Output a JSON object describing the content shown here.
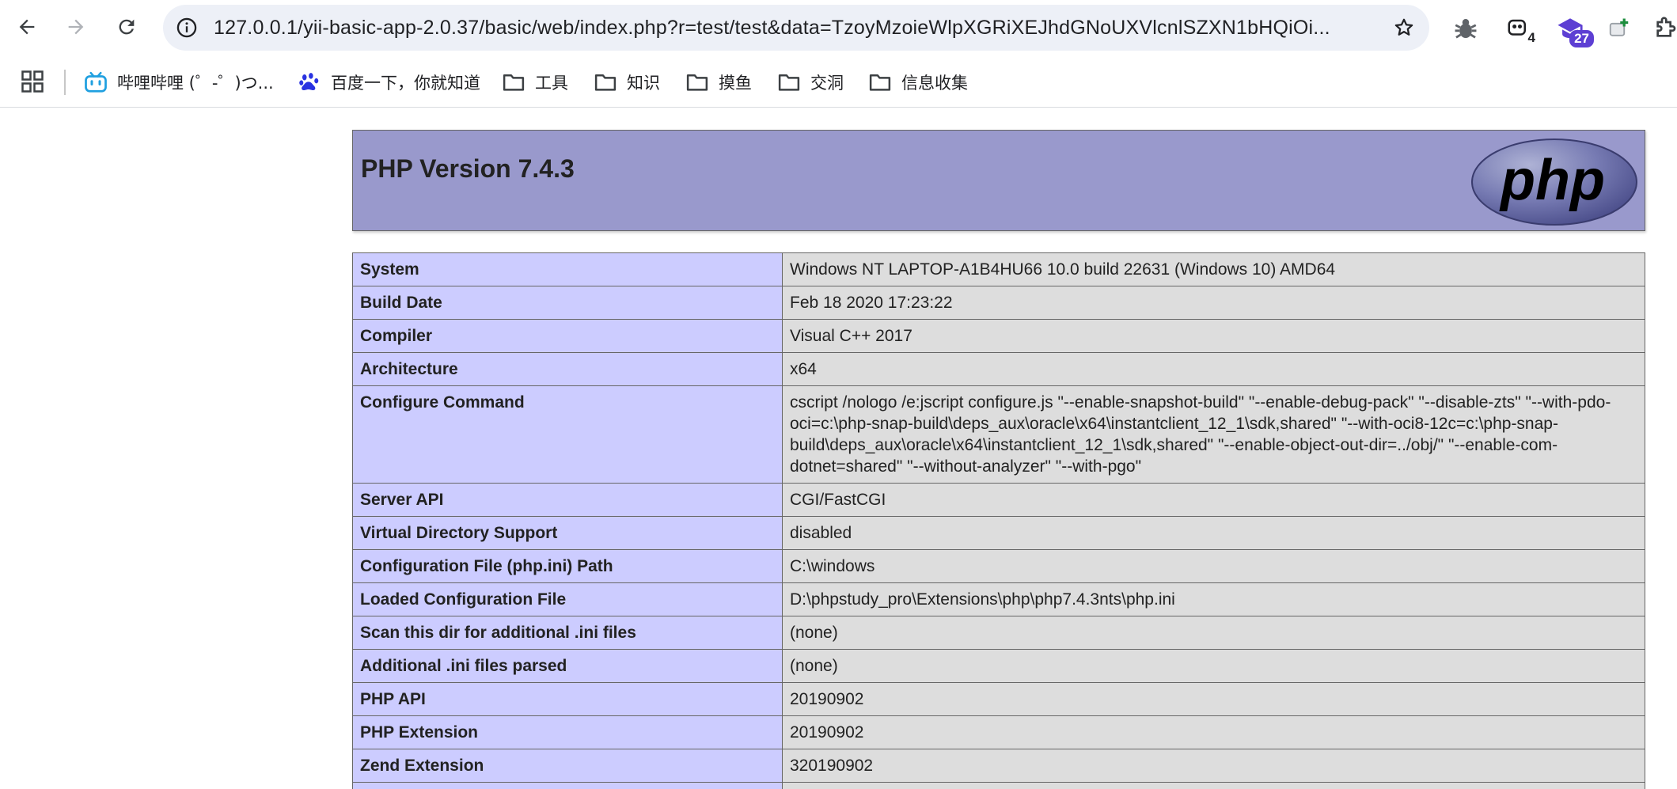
{
  "browser": {
    "url": "127.0.0.1/yii-basic-app-2.0.37/basic/web/index.php?r=test/test&data=TzoyMzoieWlpXGRiXEJhdGNoUXVlcnlSZXN1bHQiOi...",
    "extensions": [
      {
        "icon": "bug-icon",
        "badge": ""
      },
      {
        "icon": "panda-extension-icon",
        "badge": "4"
      },
      {
        "icon": "graduation-cap-icon",
        "badge": "27"
      },
      {
        "icon": "add-extension-icon",
        "badge": ""
      },
      {
        "icon": "puzzle-icon",
        "badge": ""
      }
    ],
    "accent_color": "#5d3fd3"
  },
  "bookmarks": [
    {
      "label": "哔哩哔哩 (゜-゜)つ...",
      "icon": "bilibili-icon"
    },
    {
      "label": "百度一下，你就知道",
      "icon": "baidu-paw-icon"
    },
    {
      "label": "工具",
      "icon": "folder-icon"
    },
    {
      "label": "知识",
      "icon": "folder-icon"
    },
    {
      "label": "摸鱼",
      "icon": "folder-icon"
    },
    {
      "label": "交洞",
      "icon": "folder-icon"
    },
    {
      "label": "信息收集",
      "icon": "folder-icon"
    }
  ],
  "phpinfo": {
    "title": "PHP Version 7.4.3",
    "logo_text": "php",
    "header_color": "#9999cc",
    "key_color": "#ccccff",
    "value_color": "#dddddd",
    "rows": [
      {
        "key": "System",
        "value": "Windows NT LAPTOP-A1B4HU66 10.0 build 22631 (Windows 10) AMD64"
      },
      {
        "key": "Build Date",
        "value": "Feb 18 2020 17:23:22"
      },
      {
        "key": "Compiler",
        "value": "Visual C++ 2017"
      },
      {
        "key": "Architecture",
        "value": "x64"
      },
      {
        "key": "Configure Command",
        "value": "cscript /nologo /e:jscript configure.js \"--enable-snapshot-build\" \"--enable-debug-pack\" \"--disable-zts\" \"--with-pdo-oci=c:\\php-snap-build\\deps_aux\\oracle\\x64\\instantclient_12_1\\sdk,shared\" \"--with-oci8-12c=c:\\php-snap-build\\deps_aux\\oracle\\x64\\instantclient_12_1\\sdk,shared\" \"--enable-object-out-dir=../obj/\" \"--enable-com-dotnet=shared\" \"--without-analyzer\" \"--with-pgo\""
      },
      {
        "key": "Server API",
        "value": "CGI/FastCGI"
      },
      {
        "key": "Virtual Directory Support",
        "value": "disabled"
      },
      {
        "key": "Configuration File (php.ini) Path",
        "value": "C:\\windows"
      },
      {
        "key": "Loaded Configuration File",
        "value": "D:\\phpstudy_pro\\Extensions\\php\\php7.4.3nts\\php.ini"
      },
      {
        "key": "Scan this dir for additional .ini files",
        "value": "(none)"
      },
      {
        "key": "Additional .ini files parsed",
        "value": "(none)"
      },
      {
        "key": "PHP API",
        "value": "20190902"
      },
      {
        "key": "PHP Extension",
        "value": "20190902"
      },
      {
        "key": "Zend Extension",
        "value": "320190902"
      },
      {
        "key": "",
        "value": ""
      }
    ]
  }
}
